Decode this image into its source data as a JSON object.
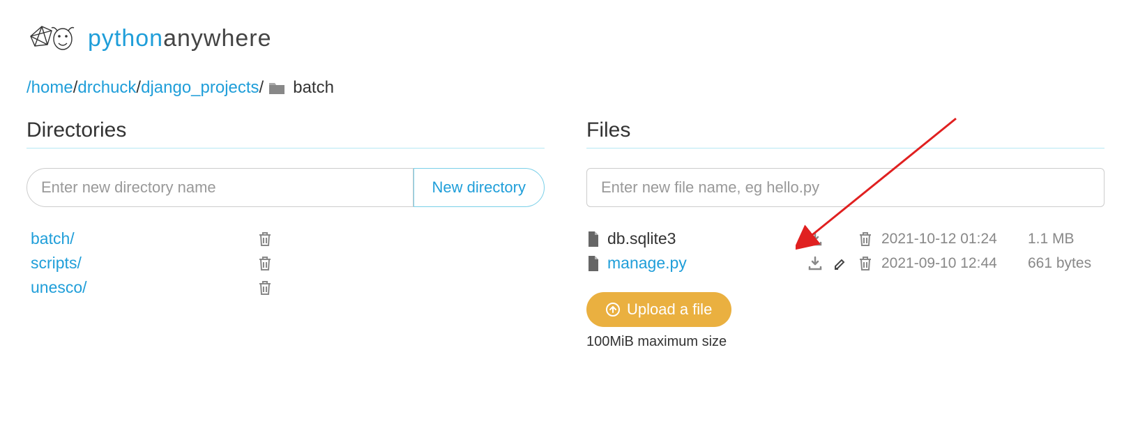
{
  "logo": {
    "python": "python",
    "anywhere": "anywhere"
  },
  "breadcrumb": {
    "parts": [
      "/home",
      "drchuck",
      "django_projects"
    ],
    "current": "batch"
  },
  "directories": {
    "title": "Directories",
    "input_placeholder": "Enter new directory name",
    "new_button": "New directory",
    "items": [
      {
        "name": "batch/"
      },
      {
        "name": "scripts/"
      },
      {
        "name": "unesco/"
      }
    ]
  },
  "files": {
    "title": "Files",
    "input_placeholder": "Enter new file name, eg hello.py",
    "items": [
      {
        "name": "db.sqlite3",
        "link": false,
        "download": true,
        "edit": false,
        "delete": true,
        "date": "2021-10-12 01:24",
        "size": "1.1 MB"
      },
      {
        "name": "manage.py",
        "link": true,
        "download": true,
        "edit": true,
        "delete": true,
        "date": "2021-09-10 12:44",
        "size": "661 bytes"
      }
    ],
    "upload_label": "Upload a file",
    "upload_note": "100MiB maximum size"
  }
}
